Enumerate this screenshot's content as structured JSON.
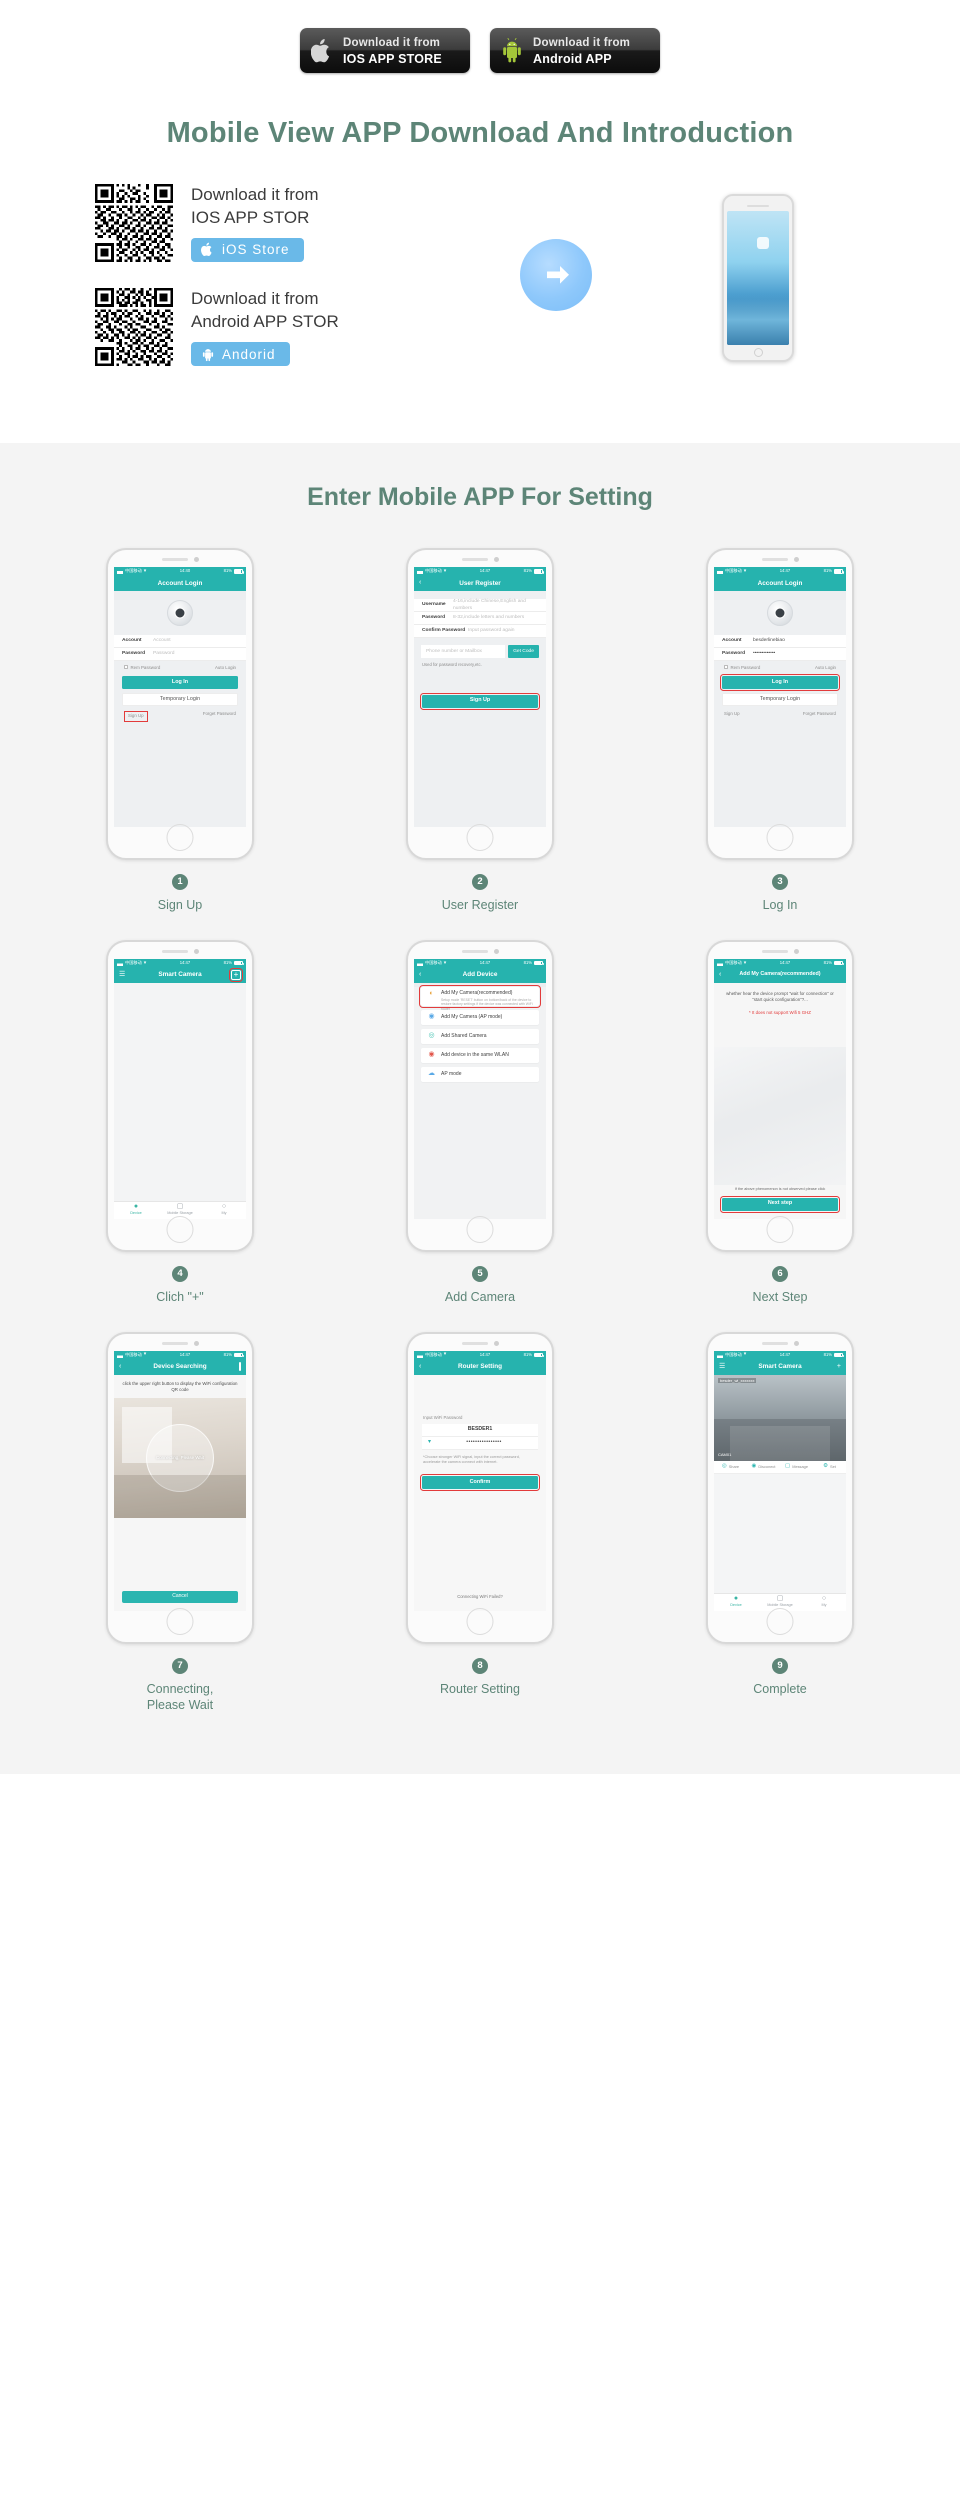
{
  "top_badges": [
    {
      "icon": "apple-icon",
      "line1": "Download it from",
      "line2": "IOS APP STORE"
    },
    {
      "icon": "android-icon",
      "line1": "Download it from",
      "line2": "Android APP"
    }
  ],
  "intro": {
    "headline": "Mobile View APP Download And Introduction",
    "downloads": [
      {
        "qr_name": "ios-qr-code",
        "line1": "Download it from",
        "line2": "IOS APP STOR",
        "pill_icon": "apple-icon",
        "pill_label": "iOS Store",
        "pill_color": "#6ab9e8"
      },
      {
        "qr_name": "android-qr-code",
        "line1": "Download it from",
        "line2": "Android APP STOR",
        "pill_icon": "android-icon",
        "pill_label": "Andorid",
        "pill_color": "#6ab9e8"
      }
    ],
    "arrow_icon": "arrow-right-icon"
  },
  "steps_section": {
    "headline": "Enter Mobile APP For Setting",
    "accent": "#5d8577",
    "brand_teal": "#26b3ae",
    "highlight_red": "#e23b3b",
    "statusbar": {
      "carrier": "中国移动",
      "time": "14:40",
      "time2": "14:47",
      "battery": "81%"
    },
    "steps": [
      {
        "num": "1",
        "caption": "Sign Up",
        "title": "Account Login",
        "time": "14:40",
        "fields": [
          {
            "label": "Account",
            "value": "Account",
            "filled": false
          },
          {
            "label": "Password",
            "value": "Password",
            "filled": false
          }
        ],
        "options": {
          "remember": "Rem Password",
          "auto": "Auto Login"
        },
        "primary_btn": "Log In",
        "secondary_btn": "Temporary Login",
        "links": {
          "left": "Sign Up",
          "right": "Forget Password"
        },
        "highlight": "signup-link"
      },
      {
        "num": "2",
        "caption": "User Register",
        "title": "User Register",
        "time": "14:47",
        "fields": [
          {
            "label": "Username",
            "value": "4-16,include Chinese,English and numbers",
            "filled": false
          },
          {
            "label": "Password",
            "value": "8-32,include letters and numbers",
            "filled": false
          },
          {
            "label": "Confirm Password",
            "value": "Input password again",
            "filled": false
          }
        ],
        "phone_field": {
          "placeholder": "Phone number or Mailbox",
          "button": "Get Code"
        },
        "hint": "Used for password recovery,etc.",
        "primary_btn": "Sign Up",
        "highlight": "signup-button"
      },
      {
        "num": "3",
        "caption": "Log In",
        "title": "Account Login",
        "time": "14:47",
        "fields": [
          {
            "label": "Account",
            "value": "besderlinebiao",
            "filled": true
          },
          {
            "label": "Password",
            "value": "•••••••••••••",
            "filled": true
          }
        ],
        "options": {
          "remember": "Rem Password",
          "auto": "Auto Login"
        },
        "primary_btn": "Log In",
        "secondary_btn": "Temporary Login",
        "links": {
          "left": "Sign Up",
          "right": "Forget Password"
        },
        "highlight": "login-button"
      },
      {
        "num": "4",
        "caption": "Clich \"+\"",
        "title": "Smart Camera",
        "time": "14:47",
        "nav_left_icon": "menu-icon",
        "nav_right_icon": "plus-icon",
        "tabs": [
          {
            "icon": "location-icon",
            "label": "Device",
            "active": true
          },
          {
            "icon": "cloud-storage-icon",
            "label": "Mobile Storage",
            "active": false
          },
          {
            "icon": "person-icon",
            "label": "My",
            "active": false
          }
        ],
        "highlight": "plus-button"
      },
      {
        "num": "5",
        "caption": "Add Camera",
        "title": "Add Device",
        "time": "14:47",
        "nav_left_icon": "back-icon",
        "list": [
          {
            "icon": "wifi-setup-icon",
            "label": "Add My Camera(recommended)",
            "highlight": true,
            "sub": "Setup mode 'RESET' button on bottom/back of the device to restore factory settings if the device was connected with WiFi router"
          },
          {
            "icon": "ap-icon",
            "label": "Add My Camera (AP mode)",
            "highlight": false,
            "sub": ""
          },
          {
            "icon": "share-icon",
            "label": "Add Shared Camera",
            "highlight": false,
            "sub": ""
          },
          {
            "icon": "lan-icon",
            "label": "Add device in the same WLAN",
            "highlight": false,
            "sub": ""
          },
          {
            "icon": "ap-mode-icon",
            "label": "AP mode",
            "highlight": false,
            "sub": ""
          }
        ],
        "highlight": "add-my-camera-row"
      },
      {
        "num": "6",
        "caption": "Next Step",
        "title": "Add My Camera(recommended)",
        "time": "14:47",
        "nav_left_icon": "back-icon",
        "prompt": "whether hear the device prompt \"wait for connection\" or \"start quick configuration\"?...",
        "warning": "* It does not support Wifi 5 GHZ",
        "note": "If the above phenomenon is not observed please click",
        "primary_btn": "Next step",
        "highlight": "next-step-button"
      },
      {
        "num": "7",
        "caption": "Connecting,\nPlease Wait",
        "title": "Device Searching",
        "time": "14:47",
        "nav_left_icon": "back-icon",
        "nav_right_icon": "qr-icon",
        "tip": "click the upper right button to display the WiFi configuration QR code",
        "ring_text": "Connecting, Please Wait",
        "cancel_btn": "Cancel",
        "highlight": "none"
      },
      {
        "num": "8",
        "caption": "Router Setting",
        "title": "Router Setting",
        "time": "14:47",
        "nav_left_icon": "back-icon",
        "label": "Input WiFi Password",
        "ssid": "BESDER1",
        "password": "••••••••••••••••",
        "hint": "*Choose stronger WiFi signal, input the correct password, accelerate the camera connect with internet.",
        "primary_btn": "Confirm",
        "fail_text": "Connecting WiFi Failed?",
        "highlight": "confirm-button"
      },
      {
        "num": "9",
        "caption": "Complete",
        "title": "Smart Camera",
        "time": "14:47",
        "nav_left_icon": "menu-icon",
        "nav_right_icon": "plus-icon",
        "video_label_top": "besder_wi_xxxxxxx",
        "video_label_bottom": "CAM01",
        "actions": [
          {
            "icon": "share-icon",
            "label": "Share"
          },
          {
            "icon": "disconnect-icon",
            "label": "Disconect"
          },
          {
            "icon": "message-icon",
            "label": "Message"
          },
          {
            "icon": "set-icon",
            "label": "Set"
          }
        ],
        "tabs": [
          {
            "icon": "location-icon",
            "label": "Device",
            "active": true
          },
          {
            "icon": "cloud-storage-icon",
            "label": "Mobile Storage",
            "active": false
          },
          {
            "icon": "person-icon",
            "label": "My",
            "active": false
          }
        ],
        "highlight": "none"
      }
    ]
  }
}
